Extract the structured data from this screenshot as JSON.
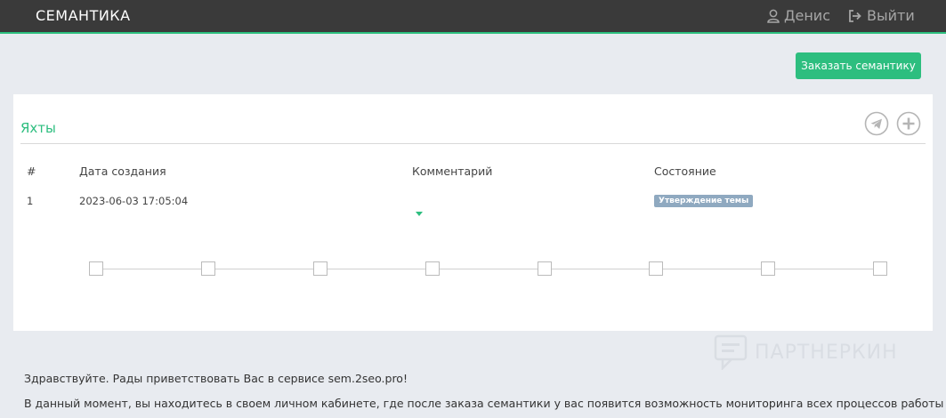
{
  "header": {
    "brand": "СЕМАНТИКА",
    "user_name": "Денис",
    "logout_label": "Выйти",
    "accent_color": "#2bbf7e"
  },
  "actions": {
    "order_button": "Заказать семантику"
  },
  "project": {
    "title": "Яхты",
    "icons": [
      "telegram-send-icon",
      "plus-circle-icon"
    ],
    "table": {
      "headers": [
        "#",
        "Дата создания",
        "Комментарий",
        "Состояние"
      ],
      "rows": [
        {
          "num": "1",
          "date": "2023-06-03 17:05:04",
          "comment": "",
          "status": "Утверждение темы"
        }
      ]
    },
    "stepper_steps": 8
  },
  "watermark": "ПАРТНЕРКИН",
  "intro": {
    "line1": "Здравствуйте. Рады приветствовать Вас в сервисе sem.2seo.pro!",
    "line2": "В данный момент, вы находитесь в своем личном кабинете, где после заказа семантики у вас появится возможность мониторинга всех процессов работы над"
  }
}
